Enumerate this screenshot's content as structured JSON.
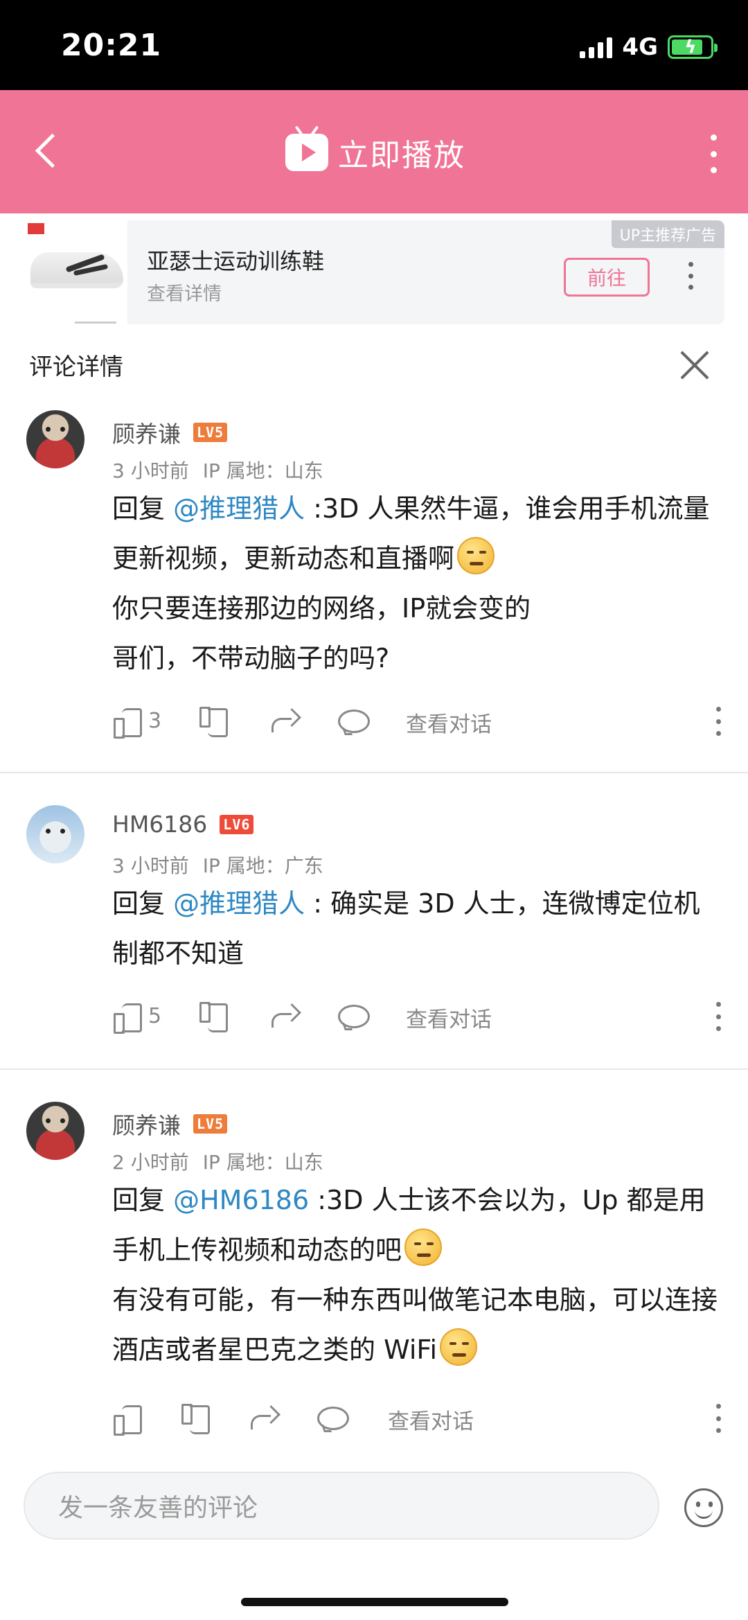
{
  "status_bar": {
    "time": "20:21",
    "network": "4G"
  },
  "header": {
    "title": "立即播放"
  },
  "ad": {
    "tag": "UP主推荐广告",
    "title": "亚瑟士运动训练鞋",
    "subtitle": "查看详情",
    "button": "前往"
  },
  "detail": {
    "title": "评论详情"
  },
  "comments": [
    {
      "user": "顾养谦",
      "level": "LV5",
      "time": "3 小时前",
      "ip": "IP 属地：山东",
      "prefix": "回复 ",
      "mention": "@推理猎人",
      "text_line1_rest": " :3D 人果然牛逼，谁会用手机流量更新视频，更新动态和直播啊",
      "text_line2": "你只要连接那边的网络，IP就会变的",
      "text_line3": "哥们，不带动脑子的吗?",
      "likes": "3",
      "view_thread": "查看对话"
    },
    {
      "user": "HM6186",
      "level": "LV6",
      "time": "3 小时前",
      "ip": "IP 属地：广东",
      "prefix": "回复 ",
      "mention": "@推理猎人",
      "text_rest": " : 确实是 3D 人士，连微博定位机制都不知道",
      "likes": "5",
      "view_thread": "查看对话"
    },
    {
      "user": "顾养谦",
      "level": "LV5",
      "time": "2 小时前",
      "ip": "IP 属地：山东",
      "prefix": "回复 ",
      "mention": "@HM6186",
      "text_line1_rest": " :3D 人士该不会以为，Up 都是用手机上传视频和动态的吧",
      "text_line2": "有没有可能，有一种东西叫做笔记本电脑，可以连接酒店或者星巴克之类的 WiFi",
      "likes": "",
      "view_thread": "查看对话"
    }
  ],
  "input": {
    "placeholder": "发一条友善的评论"
  }
}
